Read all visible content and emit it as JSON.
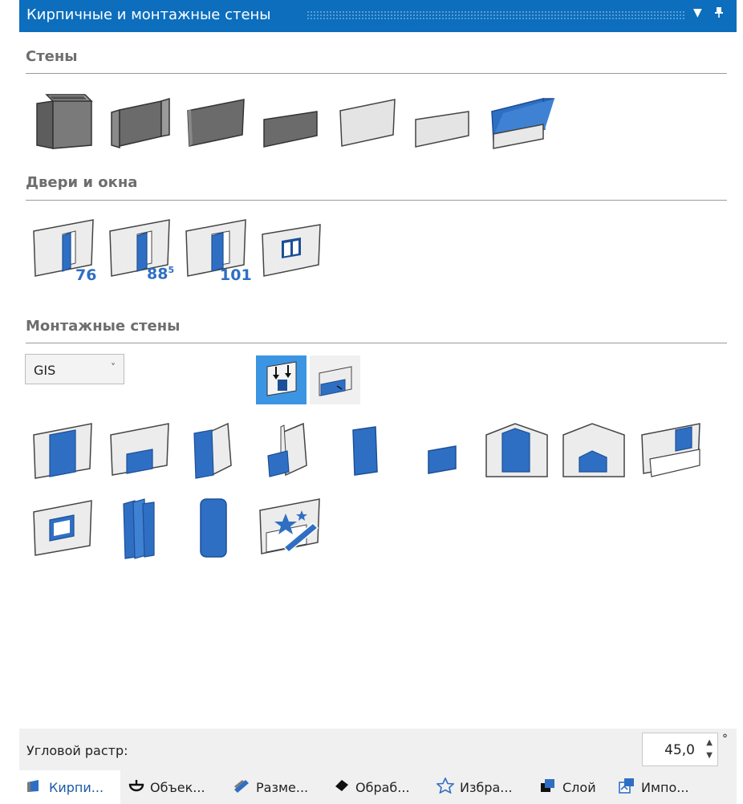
{
  "panel": {
    "title": "Кирпичные и монтажные стены",
    "menu_icon": "▼",
    "pin_icon": "📌"
  },
  "sections": {
    "walls": "Стены",
    "doors": "Двери и окна",
    "mounting": "Монтажные стены"
  },
  "doors": {
    "d1": "76",
    "d2": "88",
    "d2_sup": "5",
    "d3": "101"
  },
  "system_select": {
    "value": "GIS",
    "chevron": "˅"
  },
  "footer": {
    "label": "Угловой растр:",
    "value": "45,0",
    "unit": "°"
  },
  "tabs": [
    {
      "label": "Кирпи..."
    },
    {
      "label": "Объек..."
    },
    {
      "label": "Разме..."
    },
    {
      "label": "Обраб..."
    },
    {
      "label": "Избра..."
    },
    {
      "label": "Слой"
    },
    {
      "label": "Импо..."
    }
  ],
  "colors": {
    "accent": "#0c6ebd",
    "blue": "#2f6fc3",
    "dark_gray": "#6b6b6b",
    "light_gray": "#e8e8e8"
  }
}
